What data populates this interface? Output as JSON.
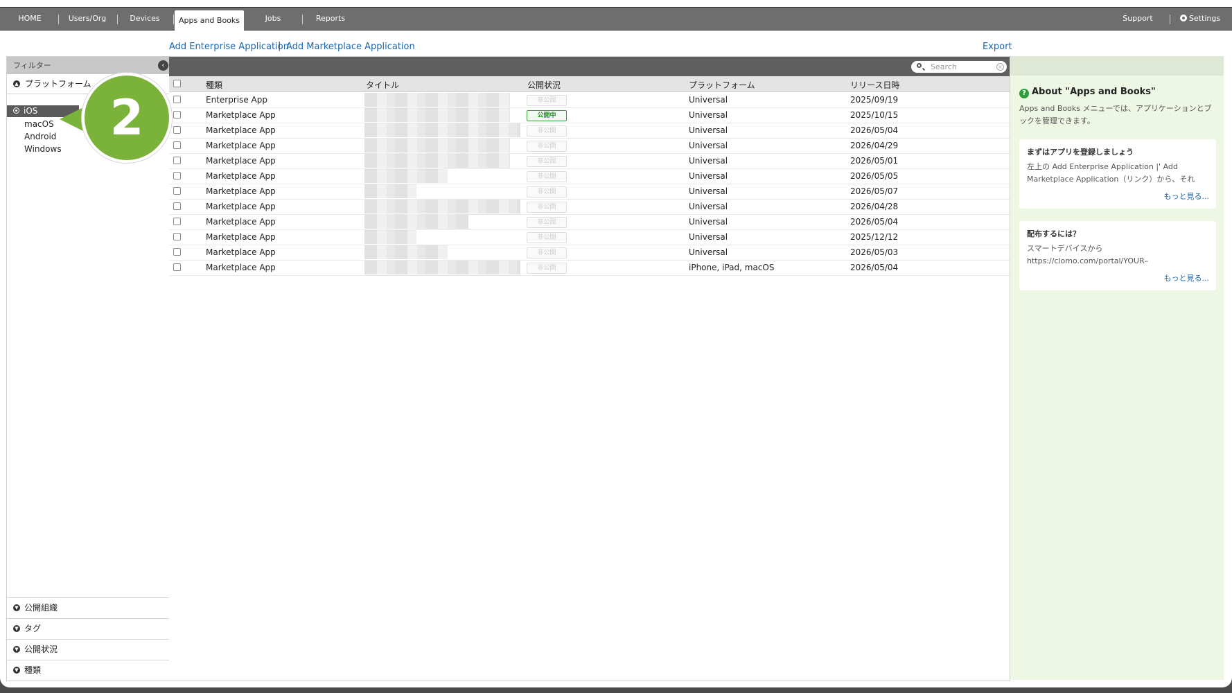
{
  "nav": {
    "tabs": [
      "HOME",
      "Users/Org",
      "Devices",
      "Apps and Books",
      "Jobs",
      "Reports"
    ],
    "active_tab": "Apps and Books",
    "support": "Support",
    "settings": "Settings"
  },
  "actions": {
    "add_enterprise": "Add Enterprise Application",
    "separator": "|",
    "add_marketplace": "Add Marketplace Application",
    "export": "Export"
  },
  "sidebar": {
    "filter_label": "フィルター",
    "platform_section": "プラットフォーム",
    "platforms": [
      "iOS",
      "macOS",
      "Android",
      "Windows"
    ],
    "selected_platform": "iOS",
    "bottom_sections": [
      "公開組織",
      "タグ",
      "公開状況",
      "種類"
    ]
  },
  "callout": {
    "number": "2"
  },
  "search": {
    "placeholder": "Search"
  },
  "table": {
    "headers": [
      "種類",
      "タイトル",
      "公開状況",
      "プラットフォーム",
      "リリース日時"
    ],
    "rows": [
      {
        "type": "Enterprise App",
        "status": "非公開",
        "platform": "Universal",
        "date": "2025/09/19"
      },
      {
        "type": "Marketplace App",
        "status": "公開中",
        "platform": "Universal",
        "date": "2025/10/15"
      },
      {
        "type": "Marketplace App",
        "status": "非公開",
        "platform": "Universal",
        "date": "2026/05/04"
      },
      {
        "type": "Marketplace App",
        "status": "非公開",
        "platform": "Universal",
        "date": "2026/04/29"
      },
      {
        "type": "Marketplace App",
        "status": "非公開",
        "platform": "Universal",
        "date": "2026/05/01"
      },
      {
        "type": "Marketplace App",
        "status": "非公開",
        "platform": "Universal",
        "date": "2026/05/05"
      },
      {
        "type": "Marketplace App",
        "status": "非公開",
        "platform": "Universal",
        "date": "2026/05/07"
      },
      {
        "type": "Marketplace App",
        "status": "非公開",
        "platform": "Universal",
        "date": "2026/04/28"
      },
      {
        "type": "Marketplace App",
        "status": "非公開",
        "platform": "Universal",
        "date": "2026/05/04"
      },
      {
        "type": "Marketplace App",
        "status": "非公開",
        "platform": "Universal",
        "date": "2025/12/12"
      },
      {
        "type": "Marketplace App",
        "status": "非公開",
        "platform": "Universal",
        "date": "2026/05/03"
      },
      {
        "type": "Marketplace App",
        "status": "非公開",
        "platform": "iPhone, iPad, macOS",
        "date": "2026/05/04"
      }
    ]
  },
  "help": {
    "title": "About \"Apps and Books\"",
    "intro": "Apps and Books メニューでは、アプリケーションとブックを管理できます。",
    "cards": [
      {
        "title": "まずはアプリを登録しましょう",
        "text": "左上の Add Enterprise Application |' Add Marketplace Application（リンク）から、それ",
        "more": "もっと見る..."
      },
      {
        "title": "配布するには？",
        "text": "スマートデバイスから https://clomo.com/portal/YOUR–",
        "more": "もっと見る..."
      }
    ]
  }
}
